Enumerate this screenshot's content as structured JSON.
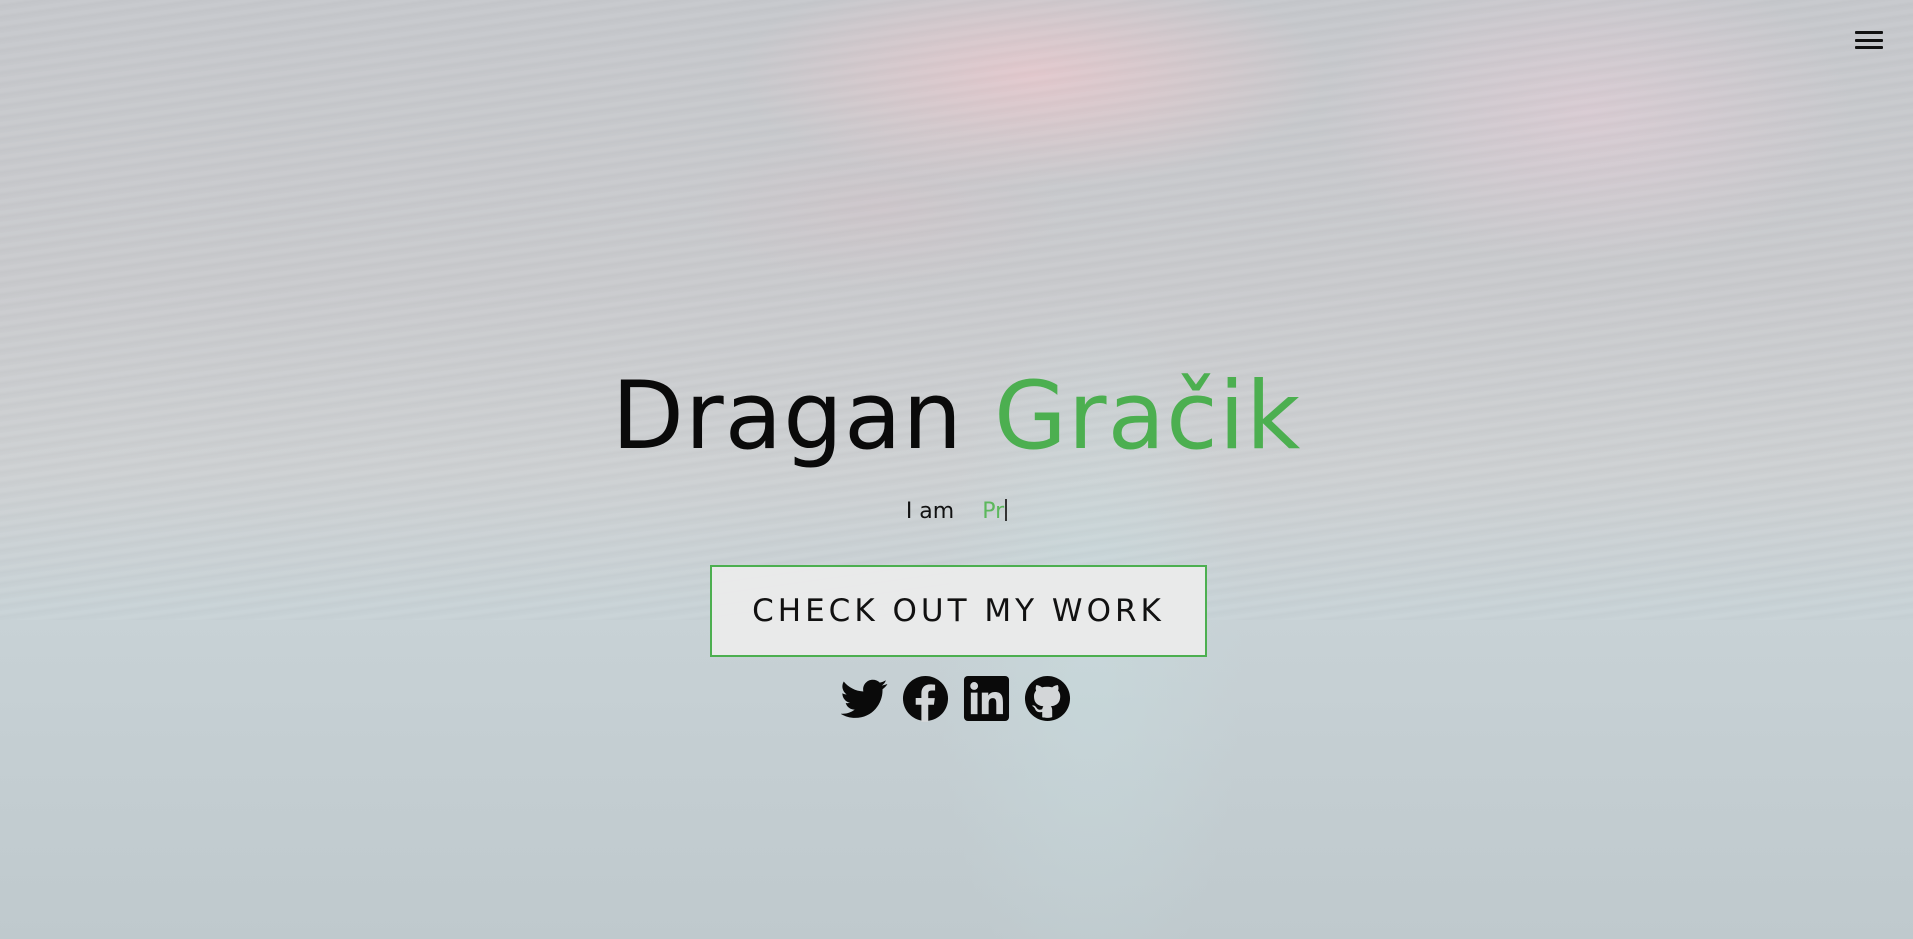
{
  "header": {
    "menu_icon": "hamburger-menu-icon"
  },
  "hero": {
    "first_name": "Dragan",
    "last_name": "Gračik",
    "tagline_prefix": "I am",
    "tagline_role": "Pr",
    "cta_label": "CHECK OUT MY WORK"
  },
  "socials": [
    {
      "name": "twitter",
      "icon": "twitter-icon"
    },
    {
      "name": "facebook",
      "icon": "facebook-icon"
    },
    {
      "name": "linkedin",
      "icon": "linkedin-icon"
    },
    {
      "name": "github",
      "icon": "github-icon"
    }
  ],
  "colors": {
    "accent": "#4caf50",
    "text": "#0a0a0a"
  }
}
